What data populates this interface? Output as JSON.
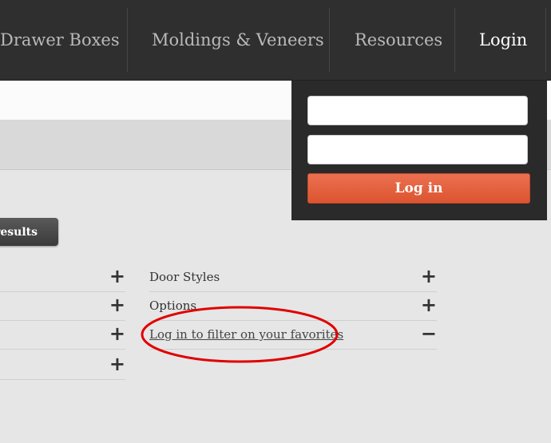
{
  "nav": {
    "items": [
      "Drawer Boxes",
      "Moldings & Veneers",
      "Resources"
    ],
    "login_label": "Login"
  },
  "search": {
    "results_button_label": "results"
  },
  "filters_left": {
    "count": 4
  },
  "filters_right": [
    {
      "label": "Door Styles",
      "toggle": "+"
    },
    {
      "label": "Options",
      "toggle": "+"
    },
    {
      "label": "Log in to filter on your favorites",
      "toggle": "−"
    }
  ],
  "filters_left_toggle": "+",
  "login_panel": {
    "username_value": "",
    "password_value": "",
    "submit_label": "Log in"
  },
  "colors": {
    "nav_bg": "#2f2f2f",
    "login_button": "#e5603c",
    "annotation": "#e00000"
  }
}
